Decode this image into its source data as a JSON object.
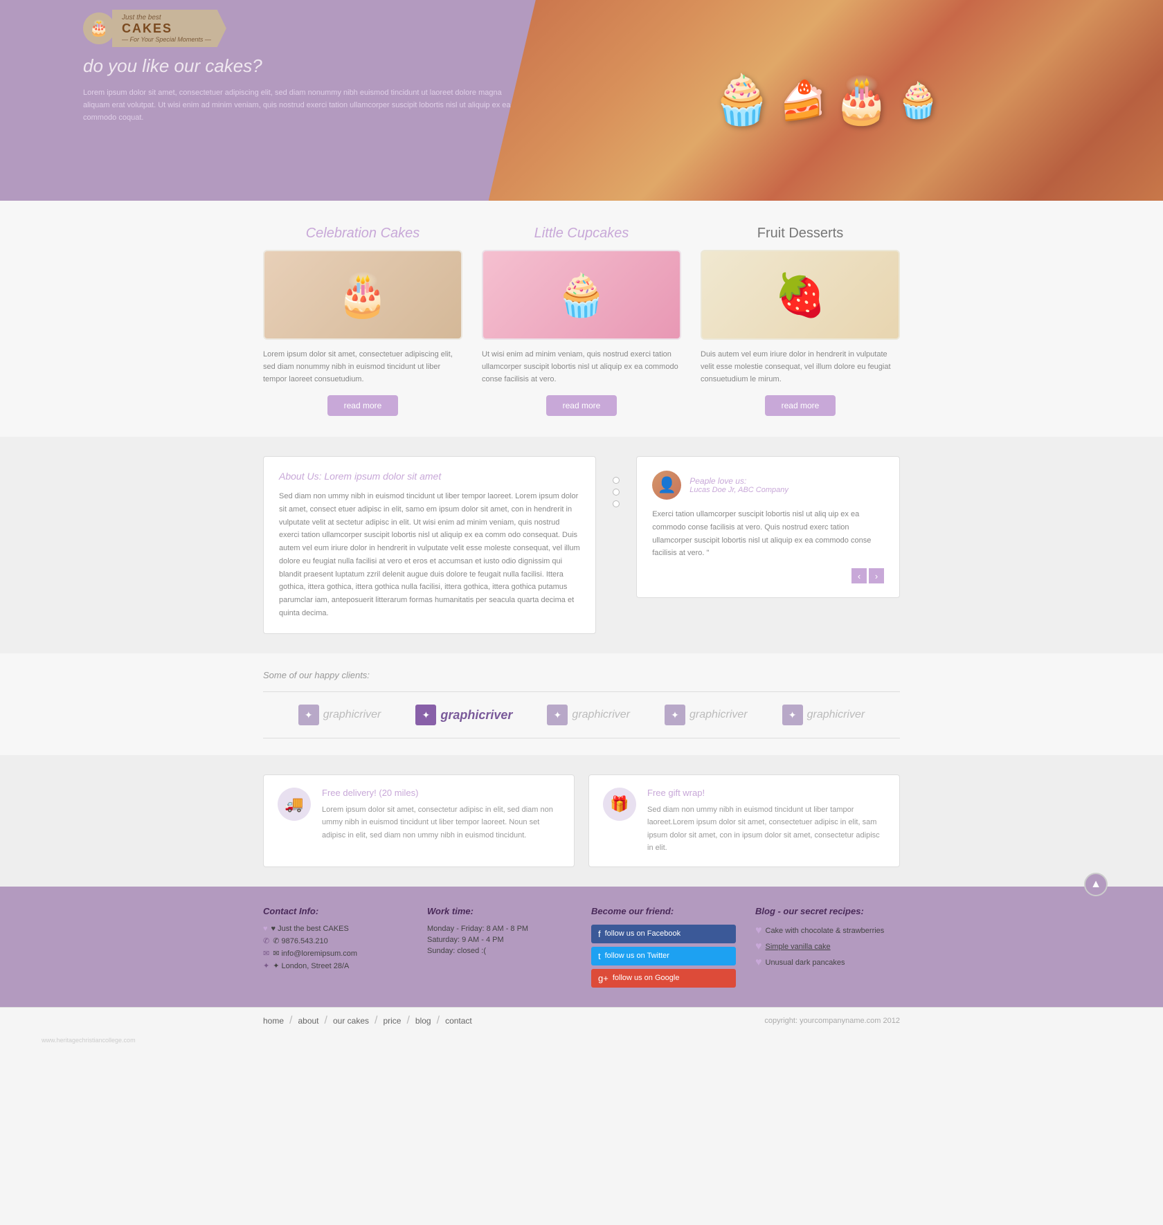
{
  "logo": {
    "just_the_best": "Just the best",
    "cakes": "CAKES",
    "tagline": "— For Your Special Moments —",
    "icon": "🎂"
  },
  "nav": {
    "items": [
      "home",
      "about",
      "our cakes",
      "price",
      "blog",
      "contact"
    ],
    "active": "home",
    "separator": "/"
  },
  "hero": {
    "title": "do you like our cakes?",
    "description": "Lorem ipsum dolor sit amet, consectetuer adipiscing elit, sed diam nonummy nibh euismod tincidunt ut laoreet dolore magna aliquam erat volutpat. Ut wisi enim ad minim veniam, quis nostrud exerci tation ullamcorper suscipit lobortis nisl ut aliquip ex ea commodo coquat.",
    "dots": 5
  },
  "featured": {
    "items": [
      {
        "title": "Celebration Cakes",
        "desc": "Lorem ipsum dolor sit amet, consectetuer adipiscing elit, sed diam nonummy nibh in euismod tincidunt ut liber tempor laoreet consuetudium.",
        "icon": "🎂",
        "read_more": "read more",
        "style": "italic"
      },
      {
        "title": "Little Cupcakes",
        "desc": "Ut wisi enim ad minim veniam, quis nostrud exerci tation ullamcorper suscipit lobortis nisl ut aliquip ex ea commodo conse facilisis at vero.",
        "icon": "🧁",
        "read_more": "read more",
        "style": "italic"
      },
      {
        "title": "Fruit Desserts",
        "desc": "Duis autem vel eum iriure dolor in hendrerit in vulputate velit esse molestie consequat, vel illum dolore eu feugiat consuetudium le mirum.",
        "icon": "🍓",
        "read_more": "read more",
        "style": "normal"
      }
    ]
  },
  "about": {
    "title": "About Us: Lorem ipsum dolor sit amet",
    "content": "Sed diam non ummy nibh in euismod tincidunt ut liber tempor laoreet. Lorem ipsum dolor sit amet, consect etuer adipisc in elit, samo em ipsum dolor sit amet, con in hendrerit in vulputate velit at sectetur adipisc in elit. Ut wisi enim ad minim veniam, quis nostrud exerci tation ullamcorper suscipit lobortis nisl ut aliquip ex ea comm odo consequat. Duis autem vel eum iriure dolor in hendrerit in vulputate velit esse moleste consequat, vel illum dolore eu feugiat nulla facilisi at vero et eros et accumsan et iusto odio dignissim qui blandit praesent luptatum zzril delenit augue duis dolore te feugait nulla facilisi. Ittera gothica, ittera gothica, ittera gothica nulla facilisi, ittera gothica, ittera gothica putamus parumclar iam, anteposuerit litterarum formas humanitatis per seacula quarta decima et quinta decima."
  },
  "testimonial": {
    "people_love": "Peaple love us:",
    "name": "Lucas Doe Jr, ABC Company",
    "content": "Exerci tation ullamcorper suscipit lobortis nisl ut aliq uip ex ea commodo conse facilisis at vero. Quis nostrud exerc tation ullamcorper suscipit lobortis nisl ut aliquip ex ea commodo conse facilisis at vero. \"",
    "prev": "‹",
    "next": "›"
  },
  "clients": {
    "title": "Some of our happy clients:",
    "logos": [
      "graphicriver",
      "graphicriver",
      "graphicriver",
      "graphicriver",
      "graphicriver"
    ]
  },
  "features": [
    {
      "title": "Free delivery! (20 miles)",
      "desc": "Lorem ipsum dolor sit amet, consectetur adipisc in elit, sed diam non ummy nibh in euismod tincidunt ut liber tempor laoreet. Noun set adipisc in elit, sed diam non ummy nibh in euismod tincidunt.",
      "icon": "🚚"
    },
    {
      "title": "Free gift wrap!",
      "desc": "Sed diam non ummy nibh in euismod tincidunt ut liber tampor laoreet.Lorem ipsum dolor sit amet, consectetuer adipisc in elit, sam ipsum dolor sit amet, con in ipsum dolor sit amet, consectetur adipisc in elit.",
      "icon": "🎁"
    }
  ],
  "footer": {
    "contact": {
      "title": "Contact Info:",
      "name_label": "♥ Just the best CAKES",
      "phone": "✆ 9876.543.210",
      "email": "✉ info@loremipsum.com",
      "address": "✦ London, Street 28/A"
    },
    "worktime": {
      "title": "Work time:",
      "lines": [
        "Monday - Friday: 8 AM - 8 PM",
        "Saturday: 9 AM - 4 PM",
        "Sunday: closed :("
      ]
    },
    "social": {
      "title": "Become our friend:",
      "facebook": "follow us on Facebook",
      "twitter": "follow us on Twitter",
      "google": "follow us on Google"
    },
    "blog": {
      "title": "Blog - our secret recipes:",
      "links": [
        "Cake with chocolate & strawberries",
        "Simple vanilla cake",
        "Unusual dark pancakes"
      ]
    },
    "bottom_nav": [
      "home",
      "about",
      "our cakes",
      "price",
      "blog",
      "contact"
    ],
    "copyright": "copyright: yourcompanyname.com 2012",
    "watermark": "www.heritagechristiancollege.com"
  }
}
